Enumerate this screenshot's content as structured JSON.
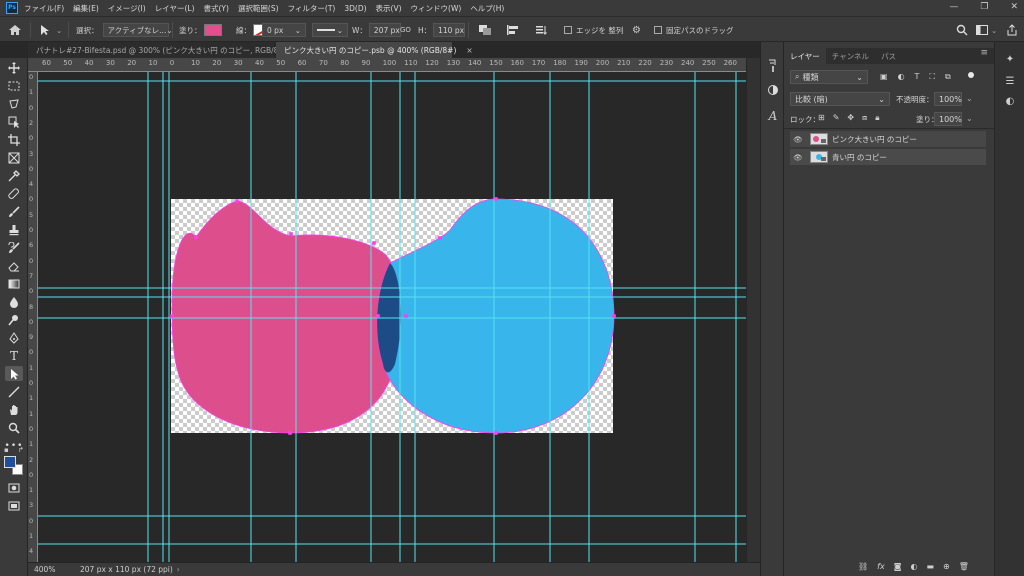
{
  "app": {
    "logo_text": "Ps",
    "menu": [
      "ファイル(F)",
      "編集(E)",
      "イメージ(I)",
      "レイヤー(L)",
      "書式(Y)",
      "選択範囲(S)",
      "フィルター(T)",
      "3D(D)",
      "表示(V)",
      "ウィンドウ(W)",
      "ヘルプ(H)"
    ],
    "window_controls": [
      "—",
      "❐",
      "✕"
    ]
  },
  "options": {
    "select_label": "選択：",
    "select_value": "アクティブなレ...",
    "fill_label": "塗り：",
    "fill_color": "#e0508f",
    "stroke_label": "線：",
    "stroke_width": "0 px",
    "w_label": "W：",
    "w_value": "207 px",
    "link_label": "GO",
    "h_label": "H：",
    "h_value": "110 px",
    "edge_align_label": "エッジを 整列",
    "fixed_path_label": "固定パスのドラッグ"
  },
  "tabs": [
    {
      "label": "パナトレ#27-Bifesta.psd @ 300% (ピンク大きい円 のコピー, RGB/8#) *",
      "active": false
    },
    {
      "label": "ピンク大きい円 のコピー.psb @ 400% (RGB/8#)",
      "active": true
    }
  ],
  "ruler": {
    "h_labels": [
      "60",
      "50",
      "40",
      "30",
      "20",
      "10",
      "0",
      "10",
      "20",
      "30",
      "40",
      "50",
      "60",
      "70",
      "80",
      "90",
      "100",
      "110",
      "120",
      "130",
      "140",
      "150",
      "160",
      "170",
      "180",
      "190",
      "200",
      "210",
      "220",
      "230",
      "240",
      "250",
      "260"
    ],
    "v_labels": [
      "0",
      "1",
      "0",
      "2",
      "0",
      "3",
      "0",
      "4",
      "0",
      "5",
      "0",
      "6",
      "0",
      "7",
      "0",
      "8",
      "0",
      "9",
      "0",
      "1",
      "0",
      "1",
      "1",
      "0",
      "1",
      "2",
      "0",
      "1",
      "3",
      "0",
      "1",
      "4"
    ]
  },
  "canvas": {
    "pink": "#dd4e8c",
    "blue": "#38b6ec",
    "overlap": "#1d4b86",
    "guide": "#55e4ee",
    "anchor": "#ff3cf0"
  },
  "status": {
    "zoom": "400%",
    "doc_info": "207 px x 110 px (72 ppi)"
  },
  "layers_panel": {
    "tabs": [
      "レイヤー",
      "チャンネル",
      "パス"
    ],
    "filter_kind": "種類",
    "blend_mode": "比較 (暗)",
    "opacity_label": "不透明度：",
    "opacity_value": "100%",
    "lock_label": "ロック：",
    "fill_label": "塗り：",
    "fill_value": "100%",
    "layers": [
      {
        "name": "ピンク大きい円 のコピー",
        "color": "#dd4e8c"
      },
      {
        "name": "青い円 のコピー",
        "color": "#38b6ec"
      }
    ],
    "footer_icons": [
      "link-icon",
      "fx-icon",
      "mask-icon",
      "adjustment-icon",
      "group-icon",
      "new-layer-icon",
      "trash-icon"
    ]
  },
  "colors": {
    "foreground": "#1f4f9c",
    "background": "#ffffff"
  }
}
